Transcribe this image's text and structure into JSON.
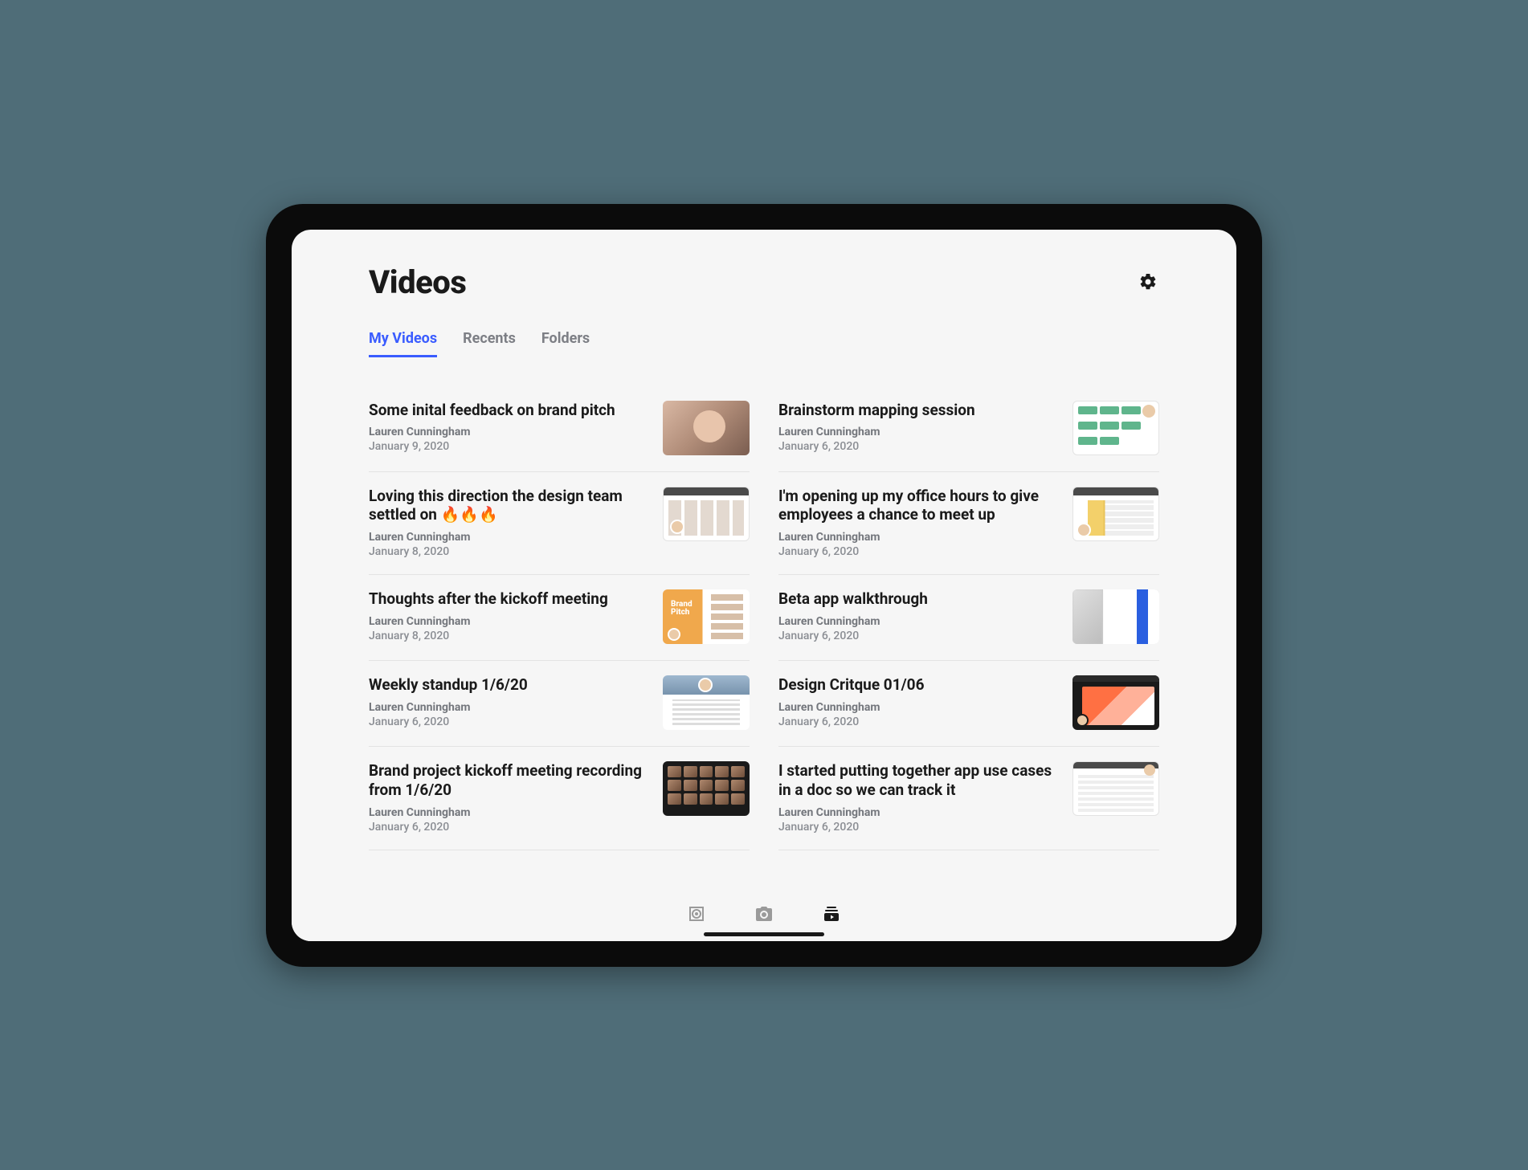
{
  "page": {
    "title": "Videos"
  },
  "tabs": [
    {
      "label": "My Videos",
      "active": true
    },
    {
      "label": "Recents",
      "active": false
    },
    {
      "label": "Folders",
      "active": false
    }
  ],
  "videos": [
    {
      "title": "Some inital feedback on brand pitch",
      "author": "Lauren Cunningham",
      "date": "January 9, 2020"
    },
    {
      "title": "Brainstorm mapping session",
      "author": "Lauren Cunningham",
      "date": "January 6, 2020"
    },
    {
      "title": "Loving this direction the design team settled on  🔥🔥🔥",
      "author": "Lauren Cunningham",
      "date": "January 8, 2020"
    },
    {
      "title": "I'm opening up my office hours to give employees a chance to meet up",
      "author": "Lauren Cunningham",
      "date": "January 6, 2020"
    },
    {
      "title": "Thoughts after the kickoff meeting",
      "author": "Lauren Cunningham",
      "date": "January 8, 2020"
    },
    {
      "title": "Beta app walkthrough",
      "author": "Lauren Cunningham",
      "date": "January 6, 2020"
    },
    {
      "title": "Weekly standup 1/6/20",
      "author": "Lauren Cunningham",
      "date": "January 6, 2020"
    },
    {
      "title": "Design Critque 01/06",
      "author": "Lauren Cunningham",
      "date": "January 6, 2020"
    },
    {
      "title": "Brand project kickoff meeting recording from 1/6/20",
      "author": "Lauren Cunningham",
      "date": "January 6, 2020"
    },
    {
      "title": "I started putting together app use cases in a doc so we can track it",
      "author": "Lauren Cunningham",
      "date": "January 6, 2020"
    }
  ],
  "nav": {
    "items": [
      {
        "name": "record-target-icon",
        "active": false
      },
      {
        "name": "camera-icon",
        "active": false
      },
      {
        "name": "library-icon",
        "active": true
      }
    ]
  },
  "thumb_hint": {
    "brand_pitch_label": "Brand\nPitch"
  }
}
